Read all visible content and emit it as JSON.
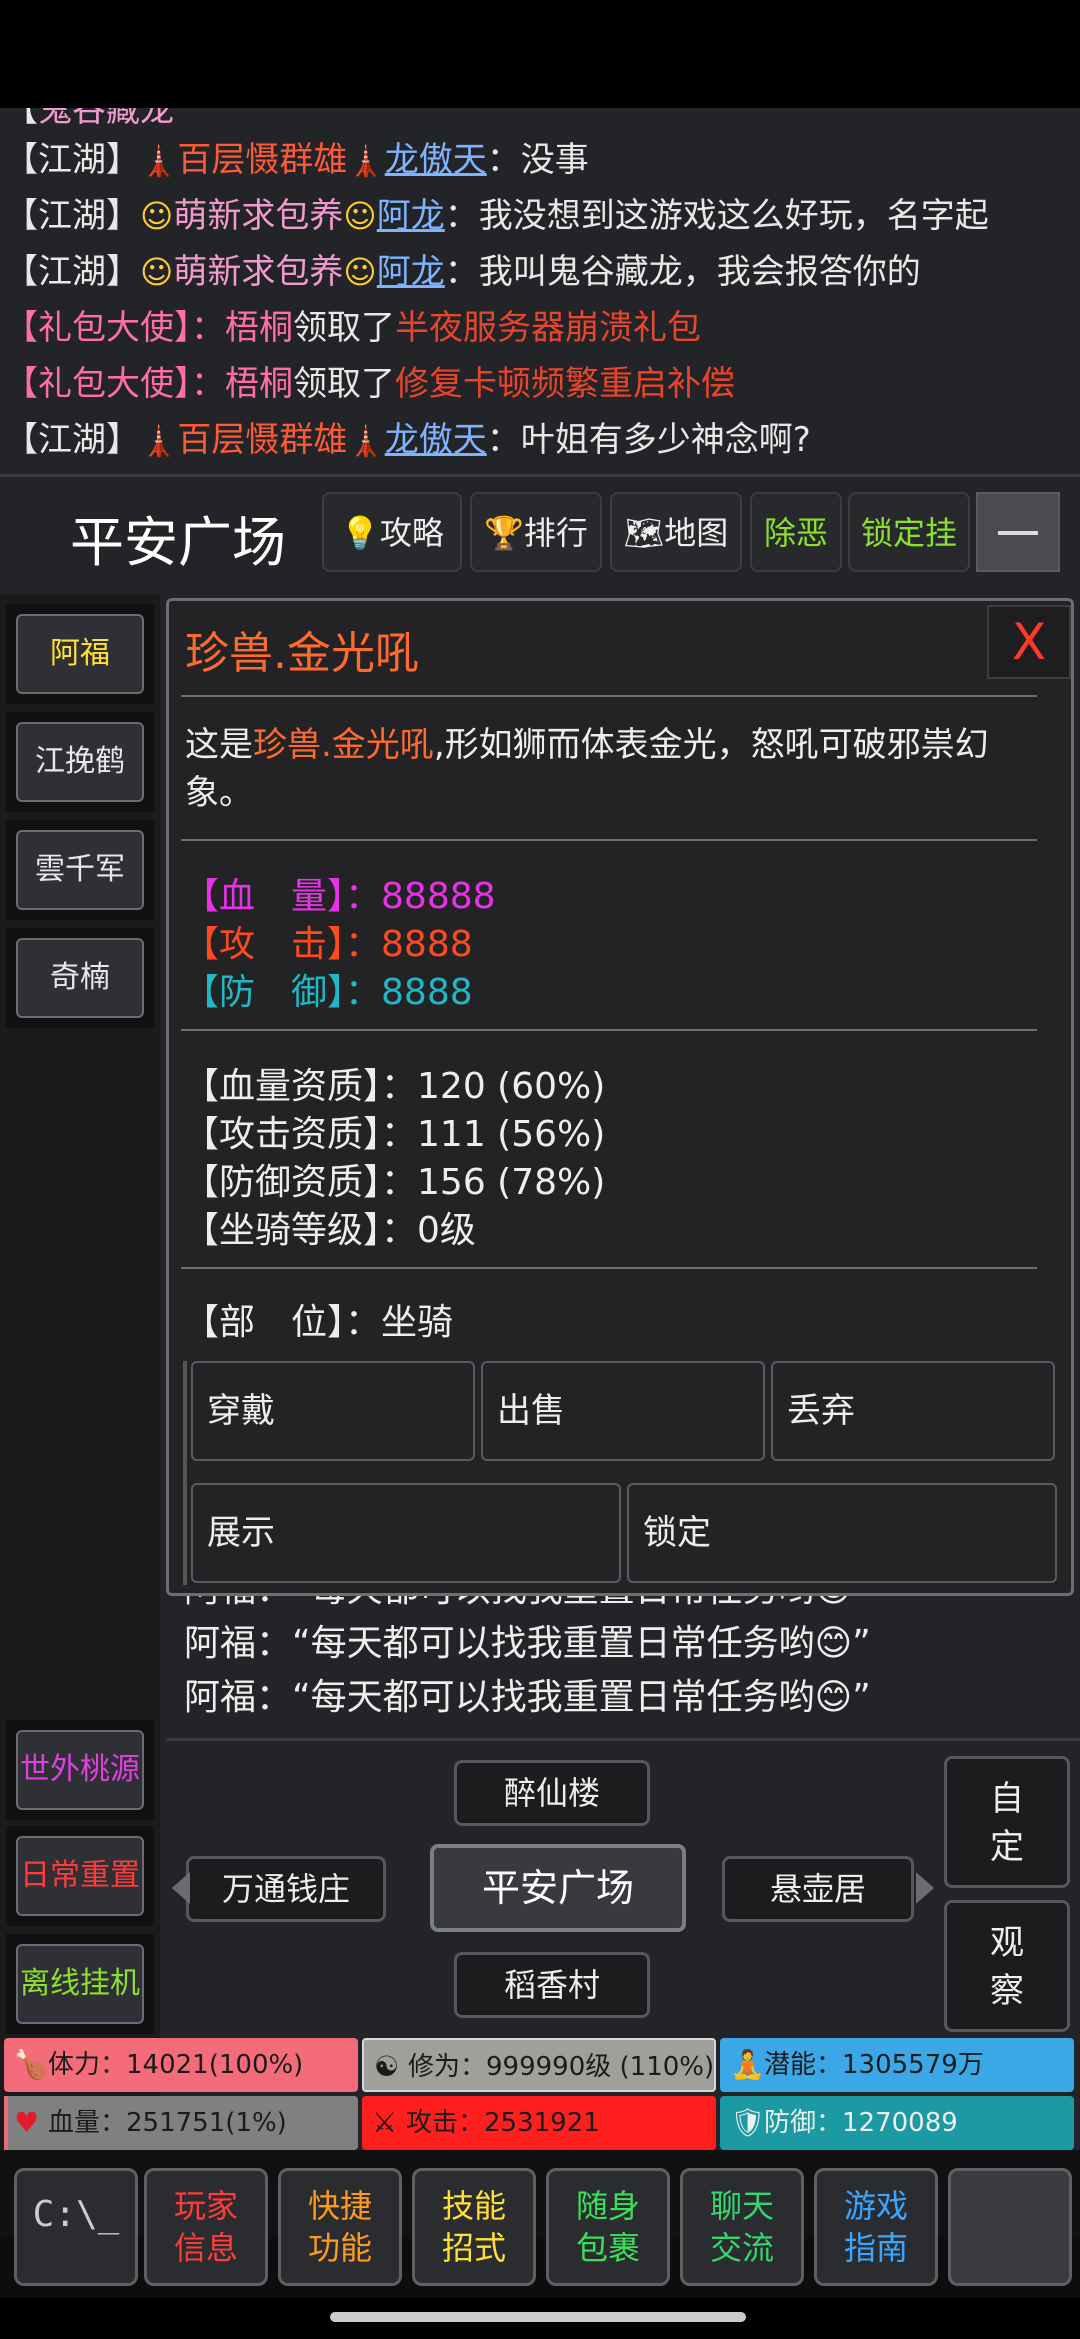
{
  "chat_log": {
    "line1": {
      "channel": "【江湖】",
      "tower1": "🗼",
      "title": "百层慑群雄",
      "tower2": "🗼",
      "name": "龙傲天",
      "msg": "：没事"
    },
    "line2": {
      "channel": "【江湖】",
      "emoji1": "☺",
      "title": "萌新求包养",
      "emoji2": "☺",
      "name": "阿龙",
      "msg": "：我没想到这游戏这么好玩，名字起"
    },
    "line3": {
      "channel": "【江湖】",
      "emoji1": "☺",
      "title": "萌新求包养",
      "emoji2": "☺",
      "name": "阿龙",
      "msg": "：我叫鬼谷藏龙，我会报答你的"
    },
    "line4": {
      "channel": "【礼包大使】",
      "sep": "：",
      "who": "梧桐",
      "verb": "领取了",
      "gift": "半夜服务器崩溃礼包"
    },
    "line5": {
      "channel": "【礼包大使】",
      "sep": "：",
      "who": "梧桐",
      "verb": "领取了",
      "gift": "修复卡顿频繁重启补偿"
    },
    "line6": {
      "channel": "【江湖】",
      "tower1": "🗼",
      "title": "百层慑群雄",
      "tower2": "🗼",
      "name": "龙傲天",
      "msg": "：叶姐有多少神念啊?"
    }
  },
  "location": {
    "title": "平安广场",
    "buttons": [
      {
        "icon": "💡",
        "label": "攻略"
      },
      {
        "icon": "🏆",
        "label": "排行"
      },
      {
        "icon": "🗺",
        "label": "地图"
      },
      {
        "label": "除恶"
      },
      {
        "label": "锁定挂"
      }
    ]
  },
  "npcs": [
    "阿福",
    "江挽鹤",
    "雲千军",
    "奇楠"
  ],
  "side_actions": [
    "世外桃源",
    "日常重置",
    "离线挂机"
  ],
  "modal": {
    "title": "珍兽.金光吼",
    "close": "X",
    "desc_prefix": "这是",
    "desc_name": "珍兽.金光吼",
    "desc_suffix": ",形如狮而体表金光，怒吼可破邪祟幻",
    "desc_line2": "象。",
    "stats": [
      {
        "label": "【血　量】：",
        "value": "88888",
        "color": "#e832e8"
      },
      {
        "label": "【攻　击】：",
        "value": "8888",
        "color": "#ff4a1f"
      },
      {
        "label": "【防　御】：",
        "value": "8888",
        "color": "#1fb8c4"
      }
    ],
    "qualities": [
      {
        "label": "【血量资质】：",
        "value": "120 (60%)"
      },
      {
        "label": "【攻击资质】：",
        "value": "111 (56%)"
      },
      {
        "label": "【防御资质】：",
        "value": "156 (78%)"
      },
      {
        "label": "【坐骑等级】：",
        "value": "0级"
      }
    ],
    "slot_label": "【部　位】：",
    "slot_value": "坐骑",
    "actions": [
      "穿戴",
      "出售",
      "丢弃",
      "展示",
      "锁定"
    ]
  },
  "npc_chat": [
    "阿福：“每天都可以找我重置日常任务哟😊”",
    "阿福：“每天都可以找我重置日常任务哟😊”",
    "阿福：“每天都可以找我重置日常任务哟😊”"
  ],
  "map": {
    "north": "醉仙楼",
    "west": "万通钱庄",
    "center": "平安广场",
    "east": "悬壶居",
    "south": "稻香村",
    "custom": [
      "自",
      "定"
    ],
    "observe": [
      "观",
      "察"
    ]
  },
  "player_stats": [
    {
      "icon": "🍗",
      "label": "体力：14021(100%)",
      "color": "#f46b7a"
    },
    {
      "icon": "☯",
      "label": "修为：999990级 (110%)",
      "color": "#a09f9b"
    },
    {
      "icon": "🧘",
      "label": "潜能：1305579万",
      "color": "#3aa7e6"
    },
    {
      "icon": "♥",
      "label": "血量：251751(1%)",
      "color": "#f06b78",
      "fill": 0.01
    },
    {
      "icon": "⚔",
      "label": "攻击：2531921",
      "color": "#ff1f1f"
    },
    {
      "icon": "🛡",
      "label": "防御：1270089",
      "color": "#1b9aa3"
    }
  ],
  "nav": [
    {
      "l1": "玩家",
      "l2": "信息",
      "color": "#ff3b3b"
    },
    {
      "l1": "快捷",
      "l2": "功能",
      "color": "#ff9a1f"
    },
    {
      "l1": "技能",
      "l2": "招式",
      "color": "#ffe135"
    },
    {
      "l1": "随身",
      "l2": "包裹",
      "color": "#3be05a"
    },
    {
      "l1": "聊天",
      "l2": "交流",
      "color": "#36d66e"
    },
    {
      "l1": "游戏",
      "l2": "指南",
      "color": "#3aa7ff"
    }
  ],
  "console_icon": "C:\\_"
}
